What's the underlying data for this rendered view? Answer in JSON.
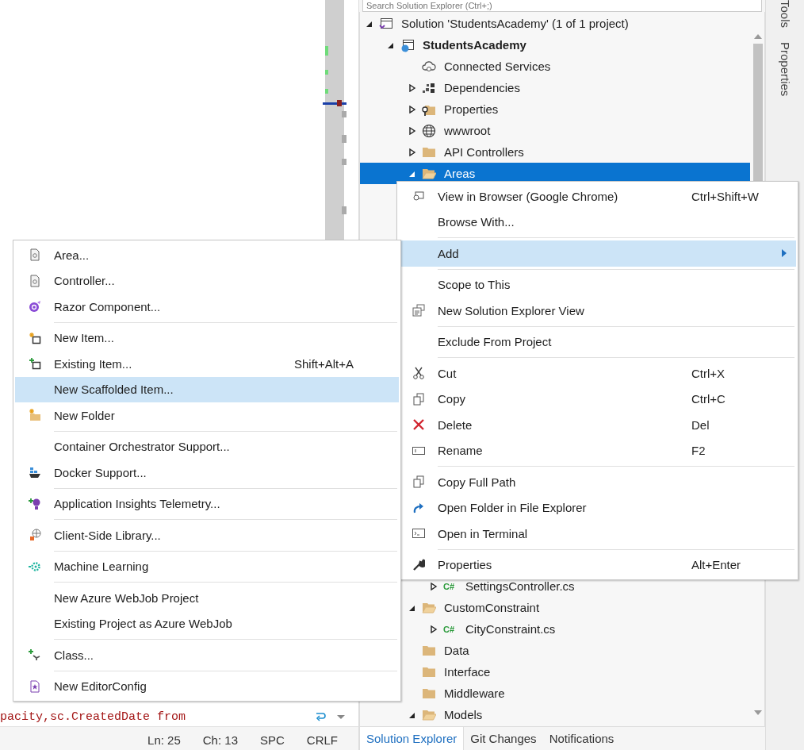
{
  "editor": {
    "code_line": "pacity,sc.CreatedDate from",
    "status": [
      "Ln: 25",
      "Ch: 13",
      "SPC",
      "CRLF"
    ]
  },
  "solution_explorer": {
    "search": {
      "placeholder": "Search Solution Explorer (Ctrl+;)"
    },
    "tree": [
      {
        "kind": "solution",
        "label": "Solution 'StudentsAcademy' (1 of 1 project)",
        "expanded": true,
        "selected": false,
        "children": [
          {
            "kind": "project",
            "label": "StudentsAcademy",
            "expanded": true,
            "selected": false,
            "children": [
              {
                "kind": "services",
                "label": "Connected Services",
                "selected": false
              },
              {
                "kind": "dependencies",
                "label": "Dependencies",
                "expanded": false,
                "selected": false
              },
              {
                "kind": "settings",
                "label": "Properties",
                "expanded": false,
                "selected": false
              },
              {
                "kind": "web",
                "label": "wwwroot",
                "expanded": false,
                "selected": false
              },
              {
                "kind": "folder",
                "label": "API Controllers",
                "expanded": false,
                "selected": false
              },
              {
                "kind": "folder",
                "label": "Areas",
                "expanded": true,
                "selected": true
              }
            ]
          }
        ]
      }
    ],
    "tree_below_menu": {
      "nested_items": [
        {
          "kind": "csharp",
          "badge": "C#",
          "label": "SettingsController.cs",
          "expanded": false,
          "selected": false
        }
      ],
      "items": [
        {
          "kind": "folder",
          "label": "CustomConstraint",
          "expanded": true,
          "selected": false,
          "children": [
            {
              "kind": "csharp",
              "badge": "C#",
              "label": "CityConstraint.cs",
              "expanded": false,
              "selected": false
            }
          ]
        },
        {
          "kind": "folder",
          "label": "Data",
          "selected": false
        },
        {
          "kind": "folder",
          "label": "Interface",
          "selected": false
        },
        {
          "kind": "folder",
          "label": "Middleware",
          "selected": false
        },
        {
          "kind": "folder",
          "label": "Models",
          "expanded": true,
          "selected": false
        }
      ]
    },
    "tabs": [
      {
        "label": "Solution Explorer",
        "selected": true
      },
      {
        "label": "Git Changes",
        "selected": false
      },
      {
        "label": "Notifications",
        "selected": false
      }
    ]
  },
  "side_tabs": [
    {
      "label": "Tools"
    },
    {
      "label": "Properties"
    }
  ],
  "context_menu": [
    {
      "kind": "item",
      "label": "View in Browser (Google Chrome)",
      "shortcut": "Ctrl+Shift+W",
      "selected": false,
      "submenu": false
    },
    {
      "kind": "item",
      "label": "Browse With...",
      "selected": false,
      "submenu": false
    },
    {
      "kind": "separator"
    },
    {
      "kind": "item",
      "label": "Add",
      "selected": true,
      "submenu": true
    },
    {
      "kind": "separator"
    },
    {
      "kind": "item",
      "label": "Scope to This",
      "selected": false,
      "submenu": false
    },
    {
      "kind": "item",
      "label": "New Solution Explorer View",
      "selected": false,
      "submenu": false
    },
    {
      "kind": "separator"
    },
    {
      "kind": "item",
      "label": "Exclude From Project",
      "selected": false,
      "submenu": false
    },
    {
      "kind": "separator"
    },
    {
      "kind": "item",
      "label": "Cut",
      "shortcut": "Ctrl+X",
      "selected": false,
      "submenu": false
    },
    {
      "kind": "item",
      "label": "Copy",
      "shortcut": "Ctrl+C",
      "selected": false,
      "submenu": false
    },
    {
      "kind": "item",
      "label": "Delete",
      "shortcut": "Del",
      "selected": false,
      "submenu": false
    },
    {
      "kind": "item",
      "label": "Rename",
      "shortcut": "F2",
      "selected": false,
      "submenu": false
    },
    {
      "kind": "separator"
    },
    {
      "kind": "item",
      "label": "Copy Full Path",
      "selected": false,
      "submenu": false
    },
    {
      "kind": "item",
      "label": "Open Folder in File Explorer",
      "selected": false,
      "submenu": false
    },
    {
      "kind": "item",
      "label": "Open in Terminal",
      "selected": false,
      "submenu": false
    },
    {
      "kind": "separator"
    },
    {
      "kind": "item",
      "label": "Properties",
      "shortcut": "Alt+Enter",
      "selected": false,
      "submenu": false
    }
  ],
  "add_submenu": [
    {
      "kind": "item",
      "label": "Area...",
      "selected": false
    },
    {
      "kind": "item",
      "label": "Controller...",
      "selected": false
    },
    {
      "kind": "item",
      "label": "Razor Component...",
      "selected": false
    },
    {
      "kind": "separator"
    },
    {
      "kind": "item",
      "label": "New Item...",
      "selected": false
    },
    {
      "kind": "item",
      "label": "Existing Item...",
      "shortcut": "Shift+Alt+A",
      "selected": false
    },
    {
      "kind": "item",
      "label": "New Scaffolded Item...",
      "selected": true
    },
    {
      "kind": "item",
      "label": "New Folder",
      "selected": false
    },
    {
      "kind": "separator"
    },
    {
      "kind": "item",
      "label": "Container Orchestrator Support...",
      "selected": false
    },
    {
      "kind": "item",
      "label": "Docker Support...",
      "selected": false
    },
    {
      "kind": "separator"
    },
    {
      "kind": "item",
      "label": "Application Insights Telemetry...",
      "selected": false
    },
    {
      "kind": "separator"
    },
    {
      "kind": "item",
      "label": "Client-Side Library...",
      "selected": false
    },
    {
      "kind": "separator"
    },
    {
      "kind": "item",
      "label": "Machine Learning",
      "selected": false
    },
    {
      "kind": "separator"
    },
    {
      "kind": "item",
      "label": "New Azure WebJob Project",
      "selected": false
    },
    {
      "kind": "item",
      "label": "Existing Project as Azure WebJob",
      "selected": false
    },
    {
      "kind": "separator"
    },
    {
      "kind": "item",
      "label": "Class...",
      "selected": false
    },
    {
      "kind": "separator"
    },
    {
      "kind": "item",
      "label": "New EditorConfig",
      "selected": false
    }
  ]
}
